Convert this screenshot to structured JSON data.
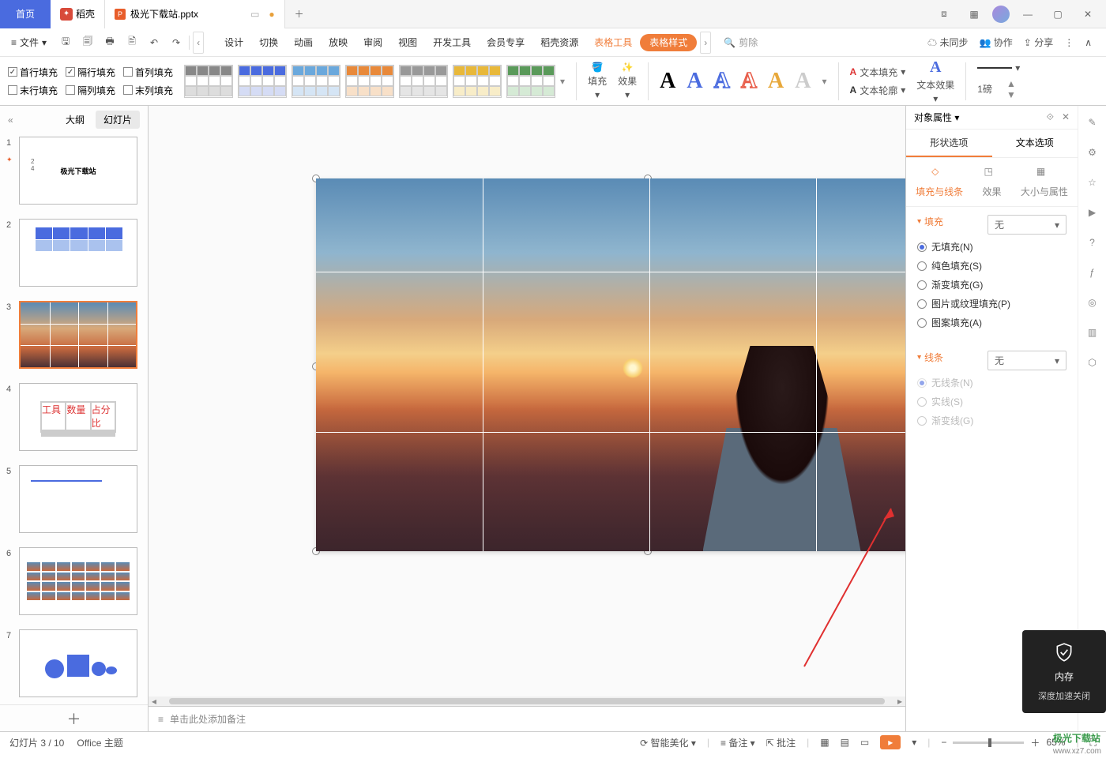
{
  "titlebar": {
    "home": "首页",
    "docer": "稻壳",
    "file_name": "极光下载站.pptx",
    "add": "＋"
  },
  "topbar": {
    "file_menu": "文件",
    "menus": [
      "设计",
      "切换",
      "动画",
      "放映",
      "审阅",
      "视图",
      "开发工具",
      "会员专享",
      "稻壳资源"
    ],
    "table_tools": "表格工具",
    "table_style": "表格样式",
    "search_placeholder": "剪除",
    "sync": "未同步",
    "collab": "协作",
    "share": "分享"
  },
  "ribbon": {
    "fill_opts": {
      "row1": [
        {
          "label": "首行填充",
          "checked": true
        },
        {
          "label": "隔行填充",
          "checked": true
        },
        {
          "label": "首列填充",
          "checked": false
        }
      ],
      "row2": [
        {
          "label": "末行填充",
          "checked": false
        },
        {
          "label": "隔列填充",
          "checked": false
        },
        {
          "label": "末列填充",
          "checked": false
        }
      ]
    },
    "fill_btn": "填充",
    "effect_btn": "效果",
    "text_fill": "文本填充",
    "text_outline": "文本轮廓",
    "text_effect": "文本效果",
    "line_weight": "1磅"
  },
  "nav": {
    "outline": "大纲",
    "slides": "幻灯片",
    "slide1_text": "极光下载站"
  },
  "notes": "单击此处添加备注",
  "props": {
    "title": "对象属性",
    "shape_opts": "形状选项",
    "text_opts": "文本选项",
    "fill_line": "填充与线条",
    "effects": "效果",
    "size_props": "大小与属性",
    "fill_section": "填充",
    "fill_none": "无",
    "fill_radios": [
      {
        "label": "无填充(N)",
        "on": true
      },
      {
        "label": "纯色填充(S)",
        "on": false
      },
      {
        "label": "渐变填充(G)",
        "on": false
      },
      {
        "label": "图片或纹理填充(P)",
        "on": false
      },
      {
        "label": "图案填充(A)",
        "on": false
      }
    ],
    "line_section": "线条",
    "line_none": "无",
    "line_radios": [
      {
        "label": "无线条(N)"
      },
      {
        "label": "实线(S)"
      },
      {
        "label": "渐变线(G)"
      }
    ]
  },
  "status": {
    "slide_info": "幻灯片 3 / 10",
    "theme": "Office 主题",
    "smart": "智能美化",
    "notes_btn": "备注",
    "comments_btn": "批注",
    "zoom": "65%"
  },
  "popup": {
    "line1": "内存",
    "line2": "深度加速关闭"
  },
  "watermark": {
    "brand": "极光下载站",
    "url": "www.xz7.com"
  },
  "chart_data": null
}
